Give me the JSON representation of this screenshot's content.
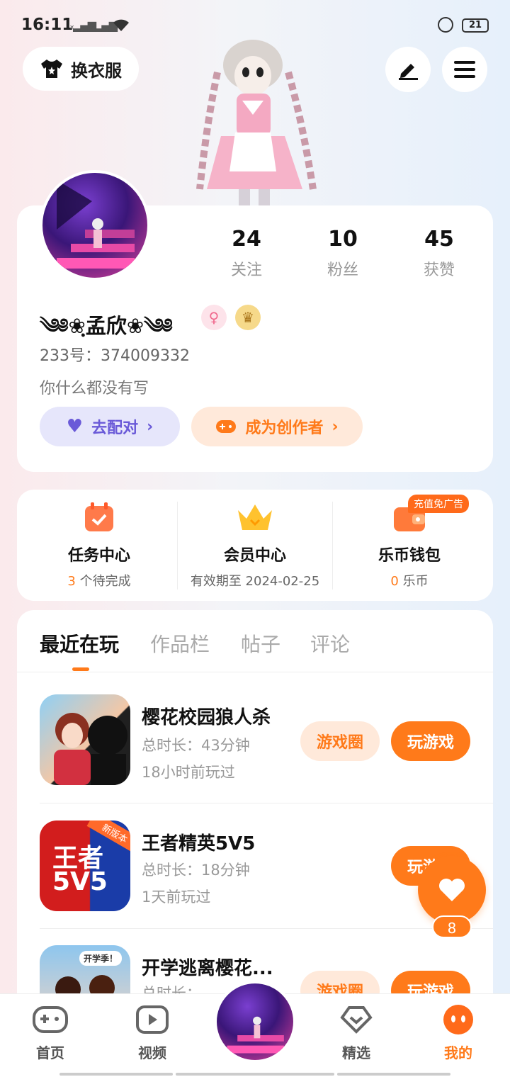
{
  "status": {
    "time": "16:11",
    "battery": "21"
  },
  "header": {
    "outfit_label": "换衣服"
  },
  "profile": {
    "stats": [
      {
        "value": "24",
        "label": "关注"
      },
      {
        "value": "10",
        "label": "粉丝"
      },
      {
        "value": "45",
        "label": "获赞"
      }
    ],
    "username": "༄༅❀ฺ孟欣❀༄༅",
    "uid": "233号：374009332",
    "bio": "你什么都没有写",
    "match_label": "去配对",
    "creator_label": "成为创作者"
  },
  "features": [
    {
      "title": "任务中心",
      "count": "3",
      "sub": " 个待完成"
    },
    {
      "title": "会员中心",
      "count": "",
      "sub": "有效期至 2024-02-25"
    },
    {
      "title": "乐币钱包",
      "count": "0",
      "sub": " 乐币"
    }
  ],
  "ad_tag": "充值免广告",
  "tabs": [
    "最近在玩",
    "作品栏",
    "帖子",
    "评论"
  ],
  "games": [
    {
      "title": "樱花校园狼人杀",
      "duration": "总时长：43分钟",
      "last_played": "18小时前玩过",
      "circle_label": "游戏圈",
      "play_label": "玩游戏"
    },
    {
      "title": "王者精英5V5",
      "duration": "总时长：18分钟",
      "last_played": "1天前玩过",
      "circle_label": "",
      "play_label": "玩游戏",
      "icon_text": "王者",
      "icon_text2": "5V5",
      "icon_ribbon": "新版本"
    },
    {
      "title": "开学逃离樱花...",
      "duration": "总时长：",
      "last_played": "",
      "circle_label": "游戏圈",
      "play_label": "玩游戏",
      "icon_bubble": "开学季！"
    }
  ],
  "like": {
    "count": "8"
  },
  "nav": [
    {
      "label": "首页"
    },
    {
      "label": "视频"
    },
    {
      "label": "精选"
    },
    {
      "label": "我的"
    }
  ]
}
